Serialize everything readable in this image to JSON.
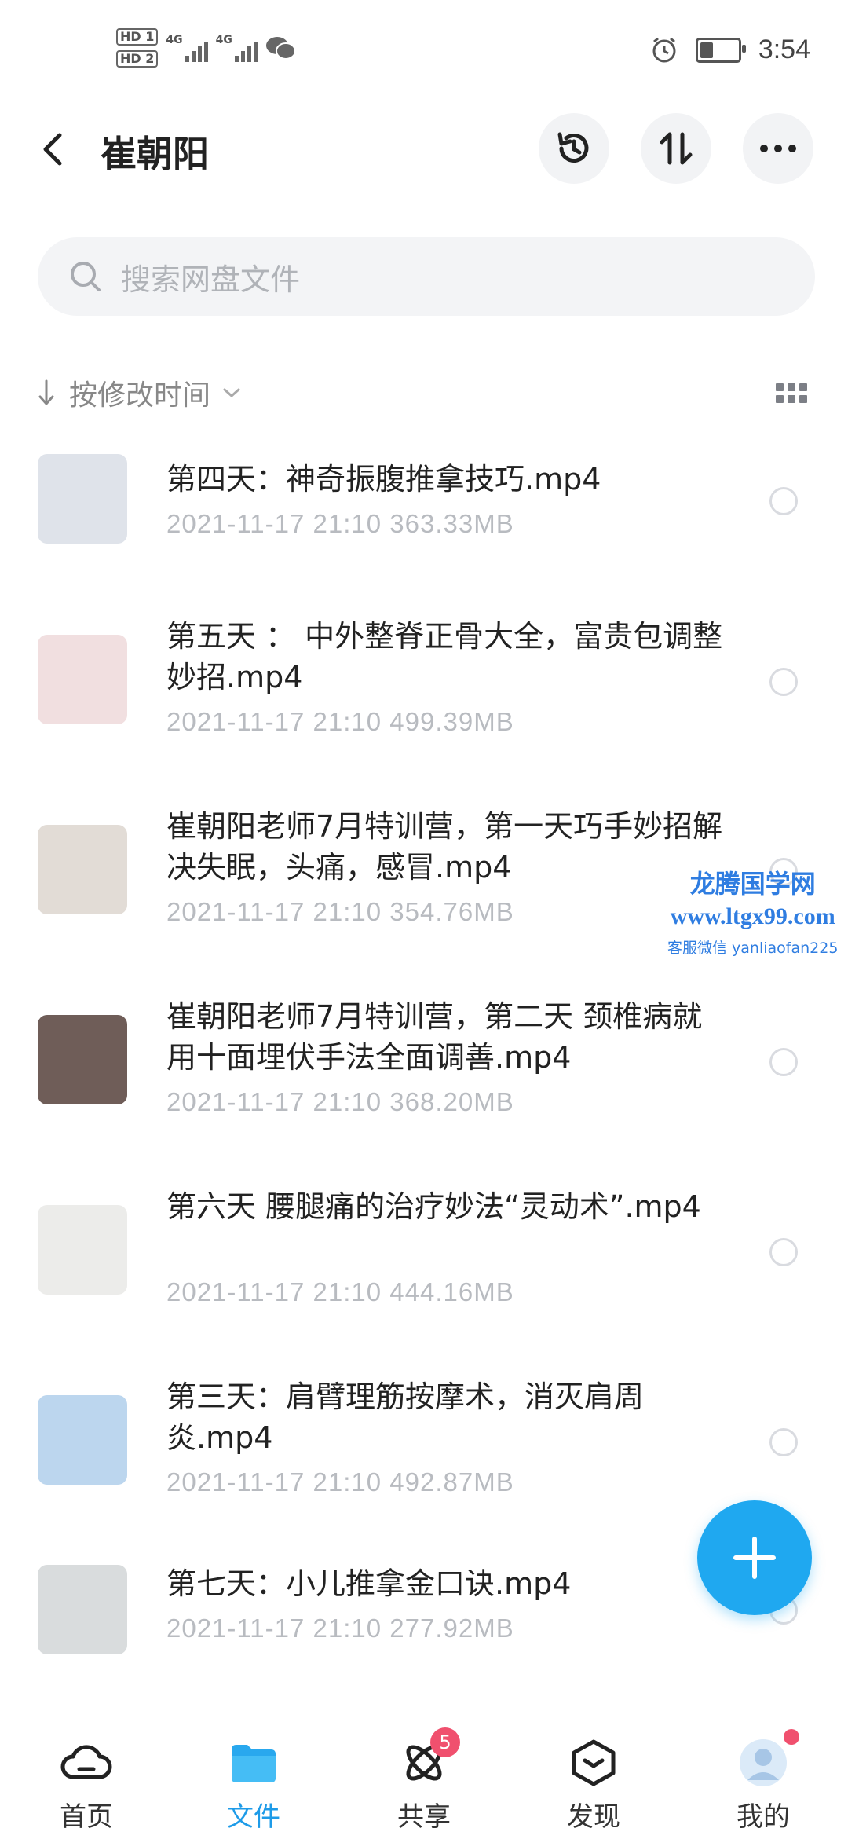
{
  "status_bar": {
    "hd1": "HD 1",
    "hd2": "HD 2",
    "net1": "4G",
    "net2": "4G",
    "time": "3:54",
    "battery_percent": 40
  },
  "header": {
    "title": "崔朝阳",
    "back_icon": "chevron-left-icon",
    "history_icon": "history-icon",
    "sort_icon": "transfer-icon",
    "more_icon": "more-icon"
  },
  "search": {
    "placeholder": "搜索网盘文件"
  },
  "sort": {
    "label": "按修改时间"
  },
  "files": [
    {
      "name": "第四天：神奇振腹推拿技巧.mp4",
      "meta": "2021-11-17  21:10  363.33MB",
      "thumb_bg": "#dfe3ea"
    },
    {
      "name": "第五天 ： 中外整脊正骨大全，富贵包调整妙招.mp4",
      "meta": "2021-11-17  21:10  499.39MB",
      "thumb_bg": "#f1dfe0"
    },
    {
      "name": "崔朝阳老师7月特训营，第一天巧手妙招解决失眠，头痛，感冒.mp4",
      "meta": "2021-11-17  21:10  354.76MB",
      "thumb_bg": "#e2dcd6"
    },
    {
      "name": "崔朝阳老师7月特训营，第二天 颈椎病就用十面埋伏手法全面调善.mp4",
      "meta": "2021-11-17  21:10  368.20MB",
      "thumb_bg": "#6f5d58"
    },
    {
      "name": "第六天 腰腿痛的治疗妙法“灵动术”.mp4",
      "meta": "2021-11-17  21:10  444.16MB",
      "thumb_bg": "#ececea"
    },
    {
      "name": "第三天：肩臂理筋按摩术，消灭肩周炎.mp4",
      "meta": "2021-11-17  21:10  492.87MB",
      "thumb_bg": "#bcd6ee"
    },
    {
      "name": "第七天：小儿推拿金口诀.mp4",
      "meta": "2021-11-17  21:10  277.92MB",
      "thumb_bg": "#d9dcdd"
    }
  ],
  "watermark": {
    "line1": "龙腾国学网",
    "line2": "www.ltgx99.com",
    "line3": "客服微信 yanliaofan225"
  },
  "nav": {
    "items": [
      {
        "label": "首页",
        "icon": "cloud-icon"
      },
      {
        "label": "文件",
        "icon": "folder-icon"
      },
      {
        "label": "共享",
        "icon": "share-orbit-icon",
        "badge": "5"
      },
      {
        "label": "发现",
        "icon": "discover-cube-icon"
      },
      {
        "label": "我的",
        "icon": "avatar-icon"
      }
    ]
  },
  "colors": {
    "accent": "#1e9be8",
    "badge": "#f0506e"
  }
}
